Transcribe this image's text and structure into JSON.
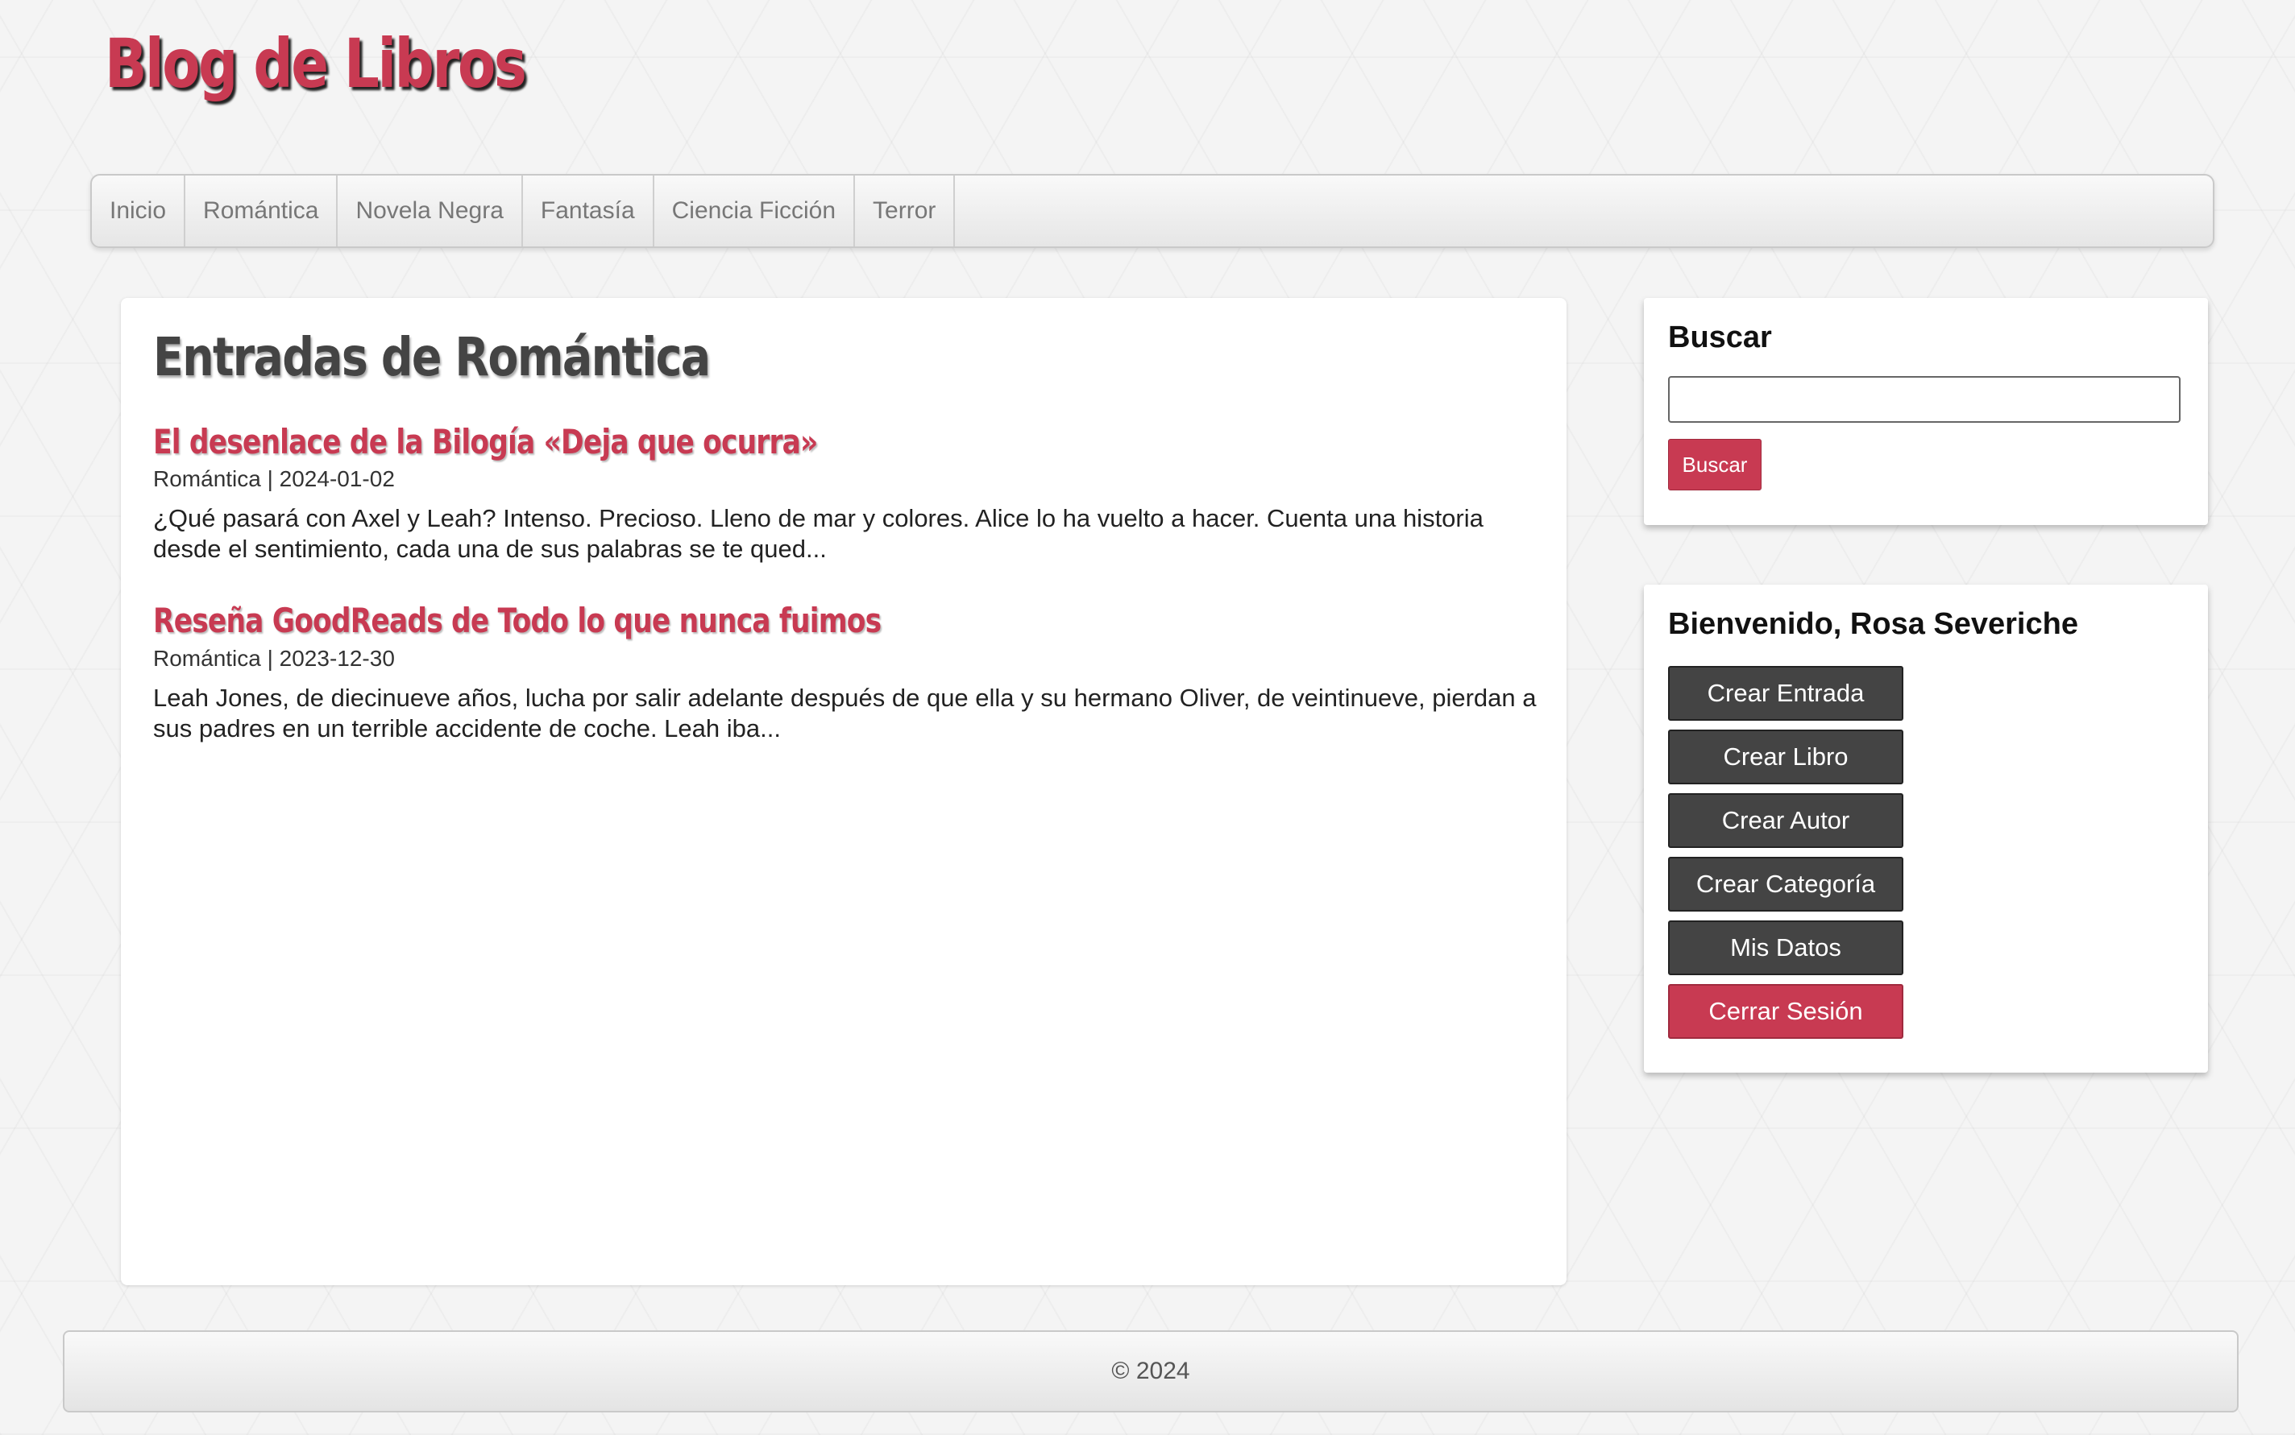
{
  "site": {
    "title": "Blog de Libros"
  },
  "nav": {
    "items": [
      {
        "label": "Inicio"
      },
      {
        "label": "Romántica"
      },
      {
        "label": "Novela Negra"
      },
      {
        "label": "Fantasía"
      },
      {
        "label": "Ciencia Ficción"
      },
      {
        "label": "Terror"
      }
    ]
  },
  "main": {
    "title": "Entradas de Romántica",
    "posts": [
      {
        "title": "El desenlace de la Bilogía «Deja que ocurra»",
        "meta": "Romántica | 2024-01-02",
        "excerpt": "¿Qué pasará con Axel y Leah? Intenso. Precioso. Lleno de mar y colores. Alice lo ha vuelto a hacer. Cuenta una historia desde el sentimiento, cada una de sus palabras se te qued..."
      },
      {
        "title": "Reseña GoodReads de Todo lo que nunca fuimos",
        "meta": "Romántica | 2023-12-30",
        "excerpt": "Leah Jones, de diecinueve años, lucha por salir adelante después de que ella y su hermano Oliver, de veintinueve, pierdan a sus padres en un terrible accidente de coche. Leah iba..."
      }
    ]
  },
  "sidebar": {
    "search": {
      "title": "Buscar",
      "input_value": "",
      "button_label": "Buscar"
    },
    "user": {
      "greeting": "Bienvenido, Rosa Severiche",
      "actions": [
        {
          "label": "Crear Entrada"
        },
        {
          "label": "Crear Libro"
        },
        {
          "label": "Crear Autor"
        },
        {
          "label": "Crear Categoría"
        },
        {
          "label": "Mis Datos"
        }
      ],
      "logout_label": "Cerrar Sesión"
    }
  },
  "footer": {
    "text": "© 2024"
  },
  "colors": {
    "accent": "#c83a52",
    "dark_button": "#444444",
    "background": "#f4f4f4"
  }
}
